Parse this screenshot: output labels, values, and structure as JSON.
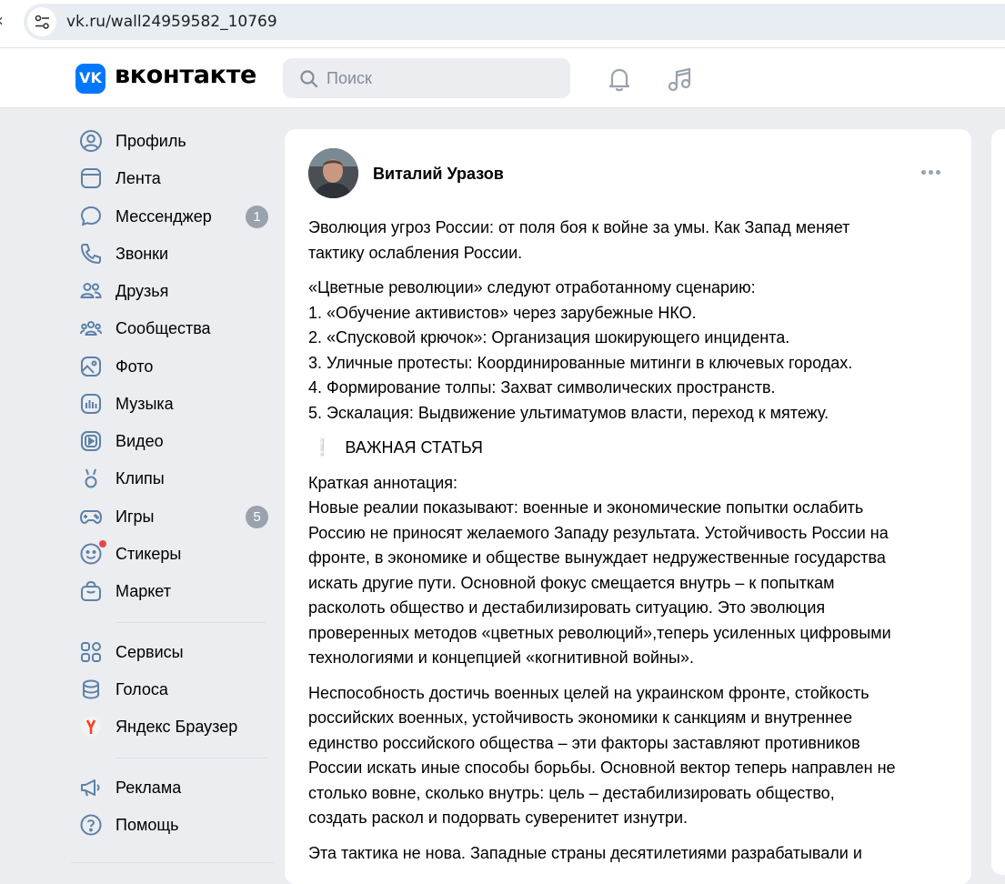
{
  "browser": {
    "url": "vk.ru/wall24959582_10769"
  },
  "header": {
    "logo_mark": "VK",
    "logo_text": "вконтакте",
    "search_placeholder": "Поиск",
    "icons": [
      "search-icon",
      "bell-icon",
      "music-icon"
    ]
  },
  "sidebar": {
    "items": [
      {
        "label": "Профиль",
        "icon": "profile-icon"
      },
      {
        "label": "Лента",
        "icon": "feed-icon"
      },
      {
        "label": "Мессенджер",
        "icon": "messenger-icon",
        "badge": "1"
      },
      {
        "label": "Звонки",
        "icon": "phone-icon"
      },
      {
        "label": "Друзья",
        "icon": "friends-icon"
      },
      {
        "label": "Сообщества",
        "icon": "communities-icon"
      },
      {
        "label": "Фото",
        "icon": "photo-icon"
      },
      {
        "label": "Музыка",
        "icon": "music-chart-icon"
      },
      {
        "label": "Видео",
        "icon": "video-icon"
      },
      {
        "label": "Клипы",
        "icon": "clips-icon"
      },
      {
        "label": "Игры",
        "icon": "gamepad-icon",
        "badge": "5"
      },
      {
        "label": "Стикеры",
        "icon": "sticker-icon"
      },
      {
        "label": "Маркет",
        "icon": "market-bag-icon"
      },
      {
        "label": "Сервисы",
        "icon": "services-grid-icon"
      },
      {
        "label": "Голоса",
        "icon": "coins-icon"
      },
      {
        "label": "Яндекс Браузер",
        "icon": "yandex-browser-icon"
      },
      {
        "label": "Реклама",
        "icon": "megaphone-icon"
      },
      {
        "label": "Помощь",
        "icon": "help-icon"
      }
    ]
  },
  "post": {
    "author": "Виталий Уразов",
    "paragraphs": [
      [
        "Эволюция угроз России: от поля боя к войне за умы. Как Запад меняет",
        "тактику ослабления России."
      ],
      [
        "«Цветные революции» следуют отработанному сценарию:",
        "1. «Обучение активистов» через зарубежные НКО.",
        "2. «Спусковой крючок»: Организация шокирующего инцидента.",
        "3. Уличные протесты: Координированные митинги в ключевых городах.",
        "4. Формирование толпы: Захват символических пространств.",
        "5. Эскалация: Выдвижение ультиматумов власти, переход к мятежу."
      ],
      [
        "ВАЖНАЯ СТАТЬЯ"
      ],
      [
        "Краткая аннотация:",
        "Новые реалии показывают: военные и экономические попытки ослабить",
        "Россию не приносят желаемого Западу результата. Устойчивость России на",
        "фронте, в экономике и обществе вынуждает недружественные государства",
        "искать другие пути. Основной фокус смещается внутрь – к попыткам",
        "расколоть общество и дестабилизировать ситуацию. Это эволюция",
        "проверенных методов «цветных революций»,теперь усиленных цифровыми",
        "технологиями и концепцией «когнитивной войны»."
      ],
      [
        "Неспособность достичь военных целей на украинском фронте, стойкость",
        "российских военных, устойчивость экономики к санкциям и внутреннее",
        "единство российского общества – эти факторы заставляют противников",
        "России искать иные способы борьбы. Основной вектор теперь направлен не",
        "столько вовне, сколько внутрь: цель – дестабилизировать общество,",
        "создать раскол и подорвать суверенитет изнутри."
      ],
      [
        "Эта тактика не нова. Западные страны десятилетиями разрабатывали и"
      ]
    ],
    "exclamation": "❕"
  },
  "colors": {
    "accent": "#0077ff",
    "page_bg": "#ebedf0",
    "badge": "#99a2ad",
    "notification_dot": "#e64646"
  }
}
